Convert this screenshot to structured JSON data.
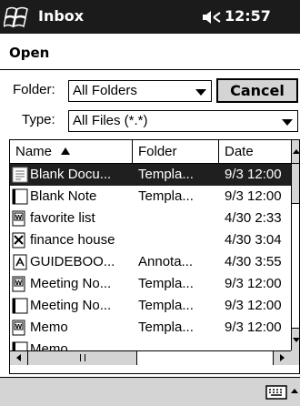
{
  "titlebar": {
    "app_title": "Inbox",
    "clock": "12:57",
    "start_icon": "windows-flag-icon",
    "volume_icon": "speaker-icon"
  },
  "dialog": {
    "title": "Open"
  },
  "folder": {
    "label": "Folder:",
    "value": "All Folders"
  },
  "type": {
    "label": "Type:",
    "value": "All Files (*.*)"
  },
  "buttons": {
    "cancel": "Cancel"
  },
  "list": {
    "columns": [
      {
        "label": "Name",
        "sort": "ascending"
      },
      {
        "label": "Folder"
      },
      {
        "label": "Date"
      }
    ],
    "rows": [
      {
        "name": "Blank Docu...",
        "folder": "Templa...",
        "date": "9/3 12:00",
        "icon": "word-template-icon",
        "selected": true
      },
      {
        "name": "Blank Note",
        "folder": "Templa...",
        "date": "9/3 12:00",
        "icon": "note-icon"
      },
      {
        "name": "favorite list",
        "folder": "",
        "date": "4/30 2:33",
        "icon": "word-doc-icon"
      },
      {
        "name": "finance house",
        "folder": "",
        "date": "4/30 3:04",
        "icon": "excel-doc-icon"
      },
      {
        "name": "GUIDEBOO...",
        "folder": "Annota...",
        "date": "4/30 3:55",
        "icon": "ebook-icon"
      },
      {
        "name": "Meeting No...",
        "folder": "Templa...",
        "date": "9/3 12:00",
        "icon": "word-doc-icon"
      },
      {
        "name": "Meeting No...",
        "folder": "Templa...",
        "date": "9/3 12:00",
        "icon": "note-icon"
      },
      {
        "name": "Memo",
        "folder": "Templa...",
        "date": "9/3 12:00",
        "icon": "word-doc-icon"
      },
      {
        "name": "Memo",
        "folder": "",
        "date": "",
        "icon": "note-icon"
      }
    ]
  },
  "bottombar": {
    "input_icon": "keyboard-icon"
  },
  "colors": {
    "titlebar": "#1b1b1b",
    "selection": "#1f1f1f",
    "chrome": "#d4d4d4"
  }
}
